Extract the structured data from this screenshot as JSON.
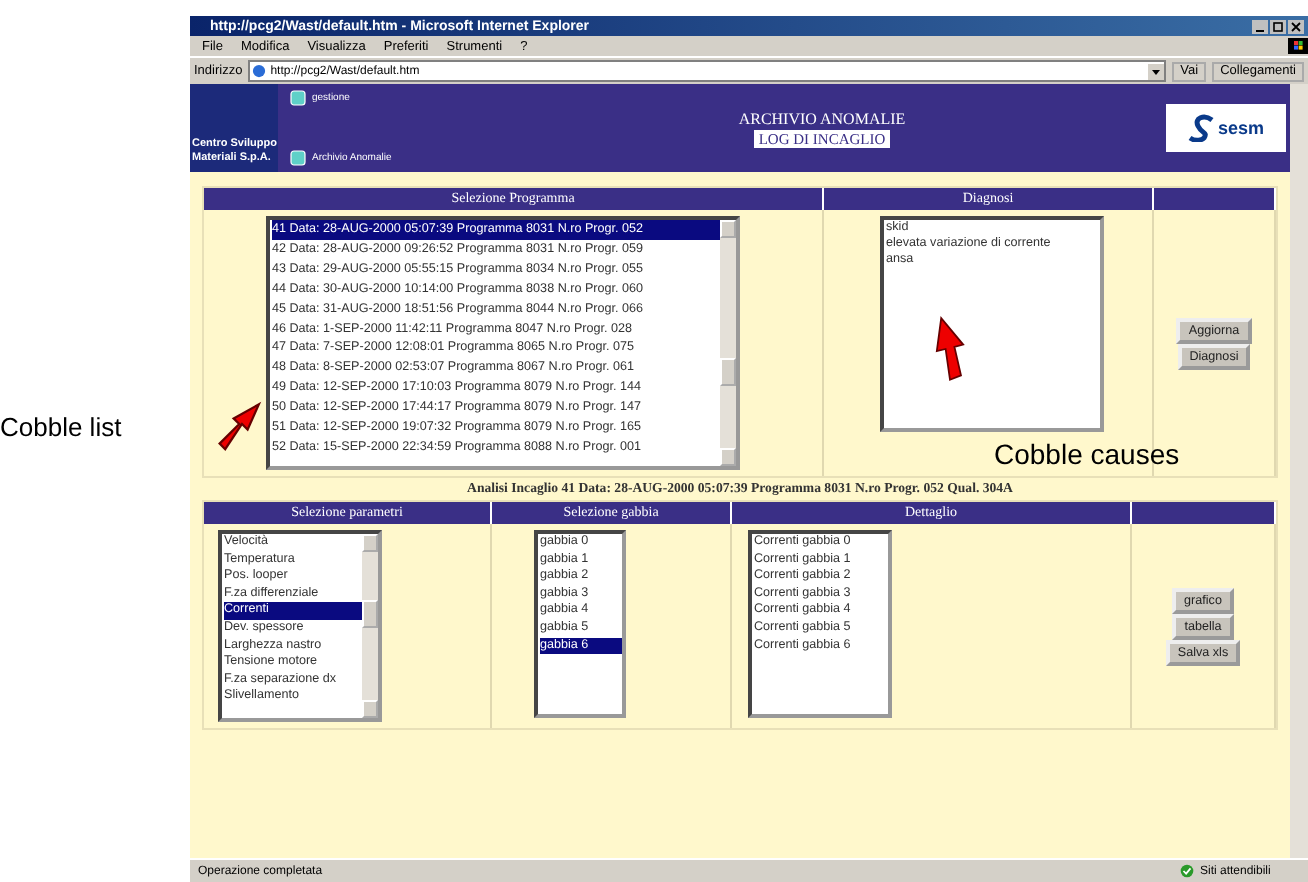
{
  "window": {
    "title": "http://pcg2/Wast/default.htm - Microsoft Internet Explorer"
  },
  "menu": [
    "File",
    "Modifica",
    "Visualizza",
    "Preferiti",
    "Strumenti",
    "?"
  ],
  "address_bar": {
    "label": "Indirizzo",
    "url": "http://pcg2/Wast/default.htm",
    "go_button": "Vai",
    "links": "Collegamenti"
  },
  "header": {
    "company_logo": [
      "Centro Sviluppo",
      "Materiali S.p.A."
    ],
    "nav_links": [
      "gestione",
      "Archivio Anomalie"
    ],
    "title": "ARCHIVIO ANOMALIE",
    "subtitle": "LOG DI INCAGLIO",
    "brand": "sesm"
  },
  "program_selection": {
    "heading": "Selezione Programma",
    "items": [
      {
        "text": "41 Data: 28-AUG-2000 05:07:39 Programma 8031 N.ro Progr. 052",
        "selected": true
      },
      {
        "text": "42 Data: 28-AUG-2000 09:26:52 Programma 8031 N.ro Progr. 059",
        "selected": false
      },
      {
        "text": "43 Data: 29-AUG-2000 05:55:15 Programma 8034 N.ro Progr. 055",
        "selected": false
      },
      {
        "text": "44 Data: 30-AUG-2000 10:14:00 Programma 8038 N.ro Progr. 060",
        "selected": false
      },
      {
        "text": "45 Data: 31-AUG-2000 18:51:56 Programma 8044 N.ro Progr. 066",
        "selected": false
      },
      {
        "text": "46 Data: 1-SEP-2000 11:42:11 Programma 8047 N.ro Progr. 028",
        "selected": false
      },
      {
        "text": "47 Data: 7-SEP-2000 12:08:01 Programma 8065 N.ro Progr. 075",
        "selected": false
      },
      {
        "text": "48 Data: 8-SEP-2000 02:53:07 Programma 8067 N.ro Progr. 061",
        "selected": false
      },
      {
        "text": "49 Data: 12-SEP-2000 17:10:03 Programma 8079 N.ro Progr. 144",
        "selected": false
      },
      {
        "text": "50 Data: 12-SEP-2000 17:44:17 Programma 8079 N.ro Progr. 147",
        "selected": false
      },
      {
        "text": "51 Data: 12-SEP-2000 19:07:32 Programma 8079 N.ro Progr. 165",
        "selected": false
      },
      {
        "text": "52 Data: 15-SEP-2000 22:34:59 Programma 8088 N.ro Progr. 001",
        "selected": false
      }
    ]
  },
  "diagnosis": {
    "heading": "Diagnosi",
    "items": [
      "skid",
      "elevata variazione di corrente",
      "ansa"
    ],
    "buttons": [
      "Aggiorna",
      "Diagnosi"
    ]
  },
  "analysis_line": "Analisi Incaglio 41 Data: 28-AUG-2000 05:07:39 Programma 8031 N.ro Progr. 052 Qual. 304A",
  "parameters": {
    "heading": "Selezione parametri",
    "items": [
      {
        "text": "Velocità",
        "selected": false
      },
      {
        "text": "Temperatura",
        "selected": false
      },
      {
        "text": "Pos. looper",
        "selected": false
      },
      {
        "text": "F.za differenziale",
        "selected": false
      },
      {
        "text": "Correnti",
        "selected": true
      },
      {
        "text": "Dev. spessore",
        "selected": false
      },
      {
        "text": "Larghezza nastro",
        "selected": false
      },
      {
        "text": "Tensione motore",
        "selected": false
      },
      {
        "text": "F.za separazione dx",
        "selected": false
      },
      {
        "text": "Slivellamento",
        "selected": false
      }
    ]
  },
  "cages": {
    "heading": "Selezione gabbia",
    "items": [
      {
        "text": "gabbia 0",
        "selected": false
      },
      {
        "text": "gabbia 1",
        "selected": false
      },
      {
        "text": "gabbia 2",
        "selected": false
      },
      {
        "text": "gabbia 3",
        "selected": false
      },
      {
        "text": "gabbia 4",
        "selected": false
      },
      {
        "text": "gabbia 5",
        "selected": false
      },
      {
        "text": "gabbia 6",
        "selected": true
      }
    ]
  },
  "detail": {
    "heading": "Dettaglio",
    "items": [
      "Correnti gabbia 0",
      "Correnti gabbia 1",
      "Correnti gabbia 2",
      "Correnti gabbia 3",
      "Correnti gabbia 4",
      "Correnti gabbia 5",
      "Correnti gabbia 6"
    ]
  },
  "actions": {
    "buttons": [
      "grafico",
      "tabella",
      "Salva xls"
    ]
  },
  "status_bar": {
    "message": "Operazione completata",
    "zone": "Siti attendibili"
  },
  "annotations": [
    {
      "text": "Cobble list"
    },
    {
      "text": "Cobble causes"
    }
  ]
}
